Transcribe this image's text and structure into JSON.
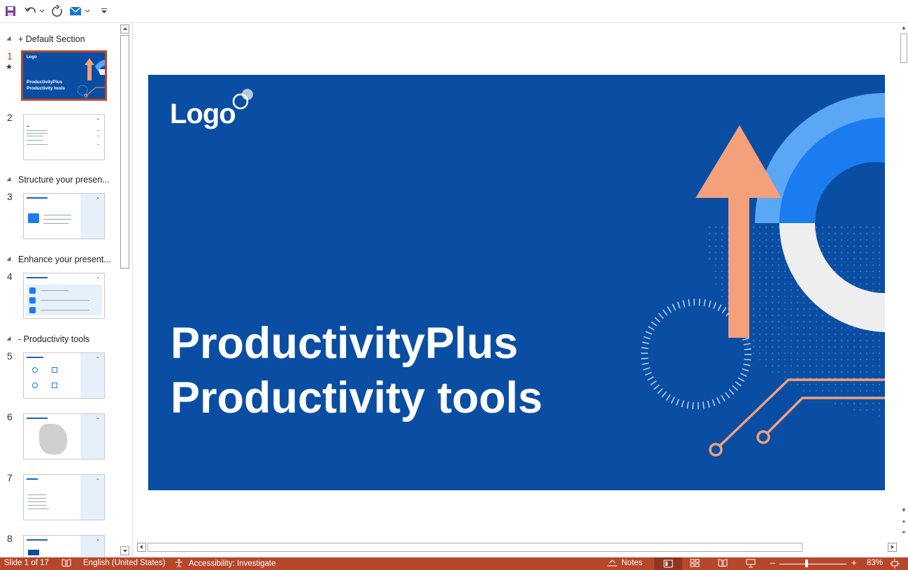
{
  "app": {
    "accent_color": "#b7472a",
    "slide_color": "#094ea3"
  },
  "qat": {
    "buttons": [
      "save-icon",
      "undo-icon",
      "redo-icon",
      "mail-icon",
      "customize-icon"
    ]
  },
  "sections": [
    {
      "label": "+ Default Section"
    },
    {
      "label": "Structure your presen..."
    },
    {
      "label": "Enhance your present..."
    },
    {
      "label": "- Productivity tools"
    }
  ],
  "slides": [
    {
      "num": "1",
      "active": true
    },
    {
      "num": "2"
    },
    {
      "num": "3"
    },
    {
      "num": "4"
    },
    {
      "num": "5"
    },
    {
      "num": "6"
    },
    {
      "num": "7"
    },
    {
      "num": "8"
    }
  ],
  "thumb1": {
    "logo": "Logo",
    "title_line1": "ProductivityPlus",
    "title_line2": "Productivity tools"
  },
  "slide": {
    "logo": "Logo",
    "title_line1": "ProductivityPlus",
    "title_line2": "Productivity tools"
  },
  "status": {
    "slide_count": "Slide 1 of 17",
    "language": "English (United States)",
    "accessibility": "Accessibility: Investigate",
    "notes": "Notes",
    "zoom": "83%"
  }
}
